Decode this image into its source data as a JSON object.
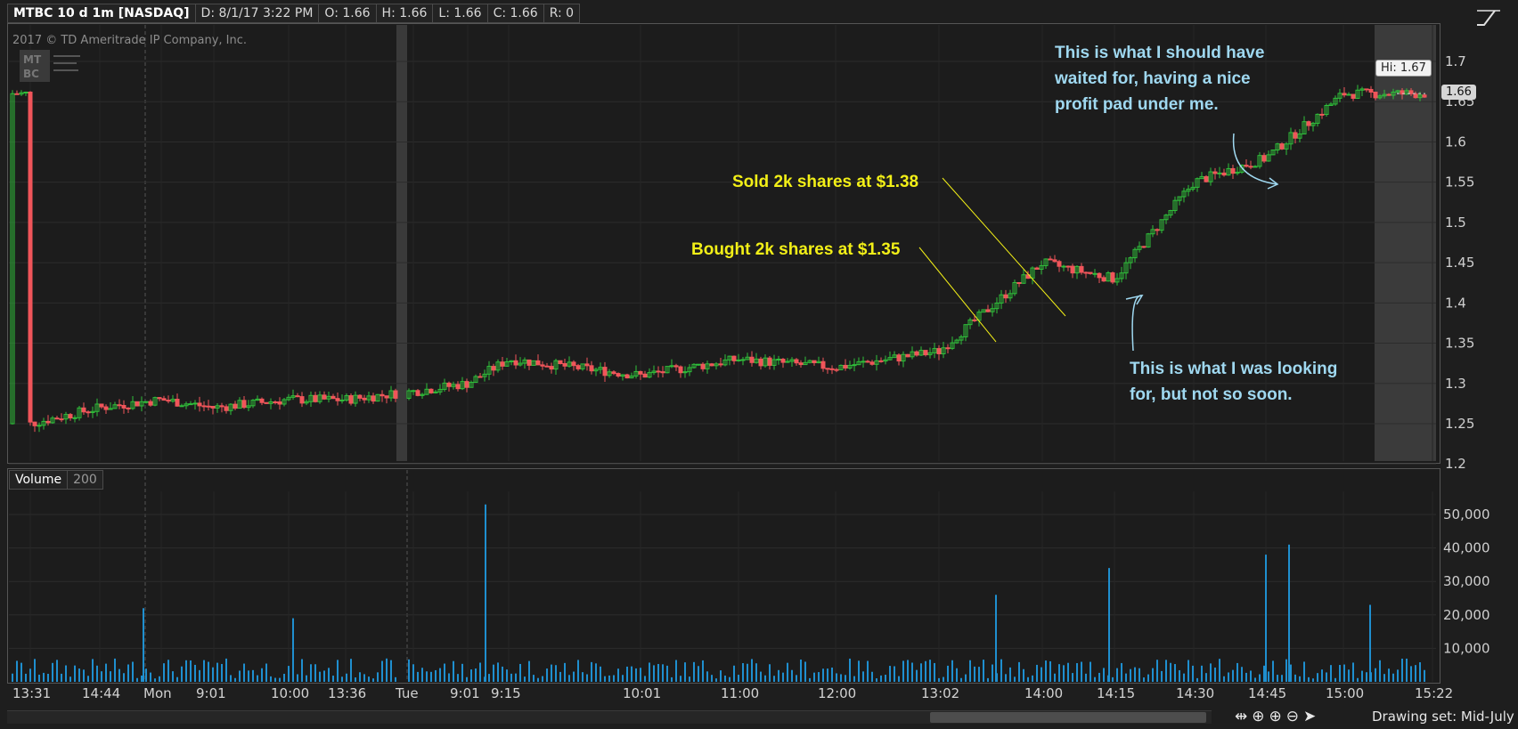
{
  "header": {
    "symbol": "MTBC 10 d 1m [NASDAQ]",
    "date": "D: 8/1/17 3:22 PM",
    "open": "O: 1.66",
    "high": "H: 1.66",
    "low": "L: 1.66",
    "close": "C: 1.66",
    "range": "R: 0"
  },
  "copyright": "2017 © TD Ameritrade IP Company, Inc.",
  "logo_text": "MTBC",
  "volume_panel": {
    "label": "Volume",
    "setting": "200"
  },
  "price_axis_labels": [
    "1.7",
    "1.65",
    "1.6",
    "1.55",
    "1.5",
    "1.45",
    "1.4",
    "1.35",
    "1.3",
    "1.25",
    "1.2"
  ],
  "volume_axis_labels": [
    "50,000",
    "40,000",
    "30,000",
    "20,000",
    "10,000"
  ],
  "time_labels": [
    "13:31",
    "14:44",
    "Mon",
    "9:01",
    "10:00",
    "13:36",
    "Tue",
    "9:01",
    "9:15",
    "10:01",
    "11:00",
    "12:00",
    "13:02",
    "14:00",
    "14:15",
    "14:30",
    "14:45",
    "15:00",
    "15:22"
  ],
  "hi_tag": "Hi: 1.67",
  "last_price_tag": "1.66",
  "annotations": {
    "sold": "Sold 2k shares at $1.38",
    "bought": "Bought 2k shares at $1.35",
    "should_wait_1": "This is what I should have",
    "should_wait_2": "waited for, having a nice",
    "should_wait_3": "profit pad under me.",
    "looking_1": "This is what I was looking",
    "looking_2": "for, but not so soon."
  },
  "footer": {
    "drawing_set": "Drawing set: Mid-July"
  },
  "colors": {
    "up": "#2fbf3a",
    "down": "#f0555a",
    "volume": "#1f8fcf",
    "annotation_yellow": "#f2ef17",
    "annotation_blue": "#9fd8f0"
  },
  "chart_data": {
    "type": "candlestick",
    "symbol": "MTBC",
    "interval": "1m",
    "x_categories": [
      "13:31",
      "14:44",
      "Mon",
      "9:01",
      "10:00",
      "13:36",
      "Tue",
      "9:01",
      "9:15",
      "10:01",
      "11:00",
      "12:00",
      "13:02",
      "14:00",
      "14:15",
      "14:30",
      "14:45",
      "15:00",
      "15:22"
    ],
    "price_ylim": [
      1.2,
      1.72
    ],
    "price_series": [
      {
        "t": "13:31",
        "close": 1.25
      },
      {
        "t": "14:44",
        "close": 1.27
      },
      {
        "t": "Mon",
        "close": 1.28
      },
      {
        "t": "9:01",
        "close": 1.27
      },
      {
        "t": "10:00",
        "close": 1.28
      },
      {
        "t": "13:36",
        "close": 1.28
      },
      {
        "t": "Tue",
        "close": 1.29
      },
      {
        "t": "9:01",
        "close": 1.3
      },
      {
        "t": "9:15",
        "close": 1.33
      },
      {
        "t": "10:01",
        "close": 1.31
      },
      {
        "t": "11:00",
        "close": 1.33
      },
      {
        "t": "12:00",
        "close": 1.32
      },
      {
        "t": "13:02",
        "close": 1.34
      },
      {
        "t": "14:00",
        "close": 1.45
      },
      {
        "t": "14:15",
        "close": 1.43
      },
      {
        "t": "14:30",
        "close": 1.55
      },
      {
        "t": "14:45",
        "close": 1.58
      },
      {
        "t": "15:00",
        "close": 1.66
      },
      {
        "t": "15:22",
        "close": 1.66
      }
    ],
    "high": 1.67,
    "last": 1.66,
    "volume_ylim": [
      0,
      55000
    ],
    "volume_spikes": [
      {
        "t": "Mon",
        "volume": 22000
      },
      {
        "t": "10:00",
        "volume": 19000
      },
      {
        "t": "9:01",
        "volume": 53000
      },
      {
        "t": "13:02",
        "volume": 26000
      },
      {
        "t": "14:00",
        "volume": 34000
      },
      {
        "t": "14:30",
        "volume": 38000
      },
      {
        "t": "14:45",
        "volume": 41000
      },
      {
        "t": "15:00",
        "volume": 23000
      }
    ],
    "annotations": [
      {
        "text": "Bought 2k shares at $1.35",
        "price": 1.35
      },
      {
        "text": "Sold 2k shares at $1.38",
        "price": 1.38
      }
    ]
  }
}
